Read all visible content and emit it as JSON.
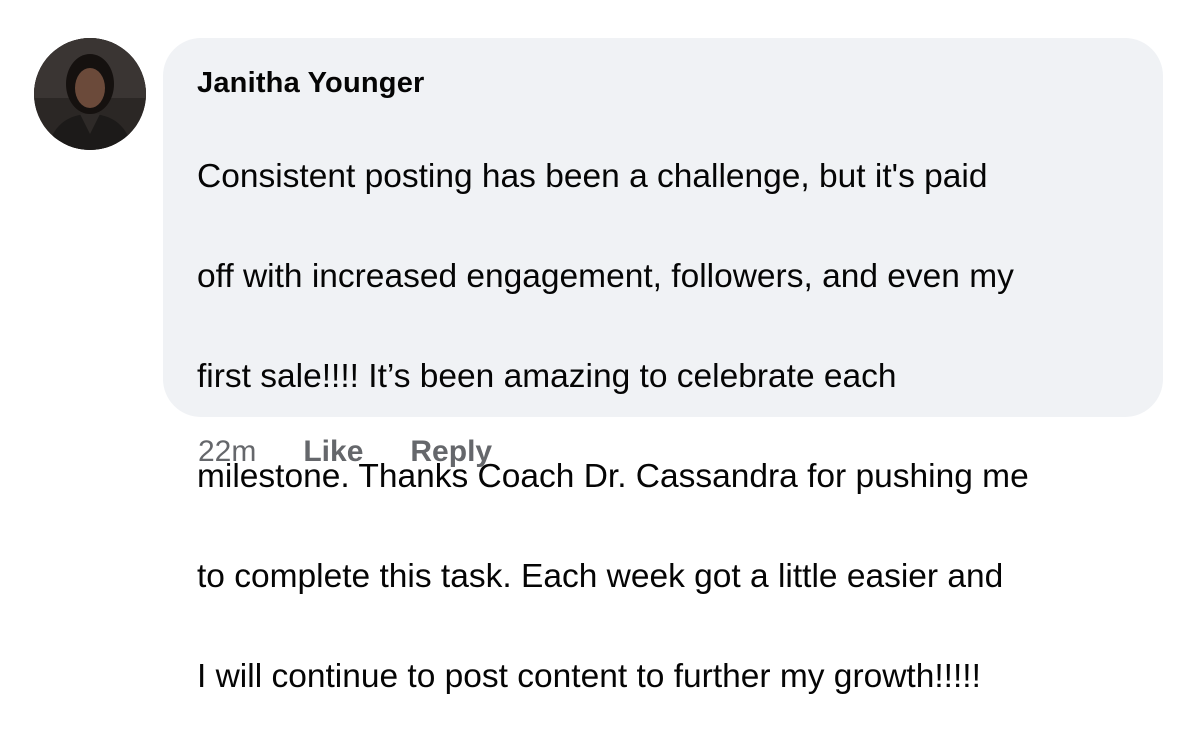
{
  "comment": {
    "author": "Janitha Younger",
    "text_lines": [
      "Consistent posting has been a challenge, but it's paid",
      "off with increased engagement, followers, and even my",
      "first sale!!!! It’s been amazing to celebrate each",
      "milestone. Thanks Coach Dr. Cassandra for pushing me",
      "to complete this task. Each week got a little easier and",
      "I will continue to post content to further my growth!!!!!"
    ],
    "timestamp": "22m",
    "like_label": "Like",
    "reply_label": "Reply"
  },
  "colors": {
    "bubble_bg": "#f0f2f5",
    "text": "#050505",
    "secondary_text": "#65676b"
  }
}
